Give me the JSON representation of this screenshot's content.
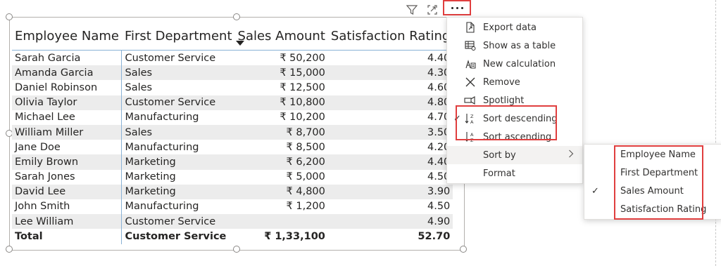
{
  "table": {
    "columns": [
      "Employee Name",
      "First Department",
      "Sales Amount",
      "Satisfaction Rating"
    ],
    "sorted_column": "Sales Amount",
    "rows": [
      [
        "Sarah Garcia",
        "Customer Service",
        "₹ 50,200",
        "4.40"
      ],
      [
        "Amanda Garcia",
        "Sales",
        "₹ 15,000",
        "4.30"
      ],
      [
        "Daniel Robinson",
        "Sales",
        "₹ 12,500",
        "4.60"
      ],
      [
        "Olivia Taylor",
        "Customer Service",
        "₹ 10,800",
        "4.80"
      ],
      [
        "Michael Lee",
        "Manufacturing",
        "₹ 10,200",
        "4.70"
      ],
      [
        "William Miller",
        "Sales",
        "₹ 8,700",
        "3.50"
      ],
      [
        "Jane Doe",
        "Manufacturing",
        "₹ 8,500",
        "4.20"
      ],
      [
        "Emily Brown",
        "Marketing",
        "₹ 6,200",
        "4.40"
      ],
      [
        "Sarah Jones",
        "Marketing",
        "₹ 5,000",
        "4.50"
      ],
      [
        "David Lee",
        "Marketing",
        "₹ 4,800",
        "3.90"
      ],
      [
        "John Smith",
        "Manufacturing",
        "₹ 1,200",
        "4.50"
      ],
      [
        "Lee William",
        "Customer Service",
        "",
        "4.90"
      ]
    ],
    "total": [
      "Total",
      "Customer Service",
      "₹ 1,33,100",
      "52.70"
    ]
  },
  "header_icons": {
    "filter": "filter-icon",
    "focus": "focus-mode-icon",
    "more": "more-options-icon"
  },
  "menu": {
    "items": [
      {
        "label": "Export data",
        "icon": "export-icon"
      },
      {
        "label": "Show as a table",
        "icon": "table-icon"
      },
      {
        "label": "New calculation",
        "icon": "calculation-icon"
      },
      {
        "label": "Remove",
        "icon": "close-icon"
      },
      {
        "label": "Spotlight",
        "icon": "spotlight-icon"
      },
      {
        "label": "Sort descending",
        "icon": "sort-descending-icon",
        "checked": true
      },
      {
        "label": "Sort ascending",
        "icon": "sort-ascending-icon"
      },
      {
        "label": "Sort by",
        "icon": "chevron-right-icon"
      },
      {
        "label": "Format"
      }
    ]
  },
  "submenu": {
    "items": [
      {
        "label": "Employee Name"
      },
      {
        "label": "First Department"
      },
      {
        "label": "Sales Amount",
        "checked": true
      },
      {
        "label": "Satisfaction Rating"
      }
    ]
  },
  "colors": {
    "highlight": "#e03e3e",
    "row_band": "#ececec",
    "column_divider": "#8ab2d6"
  }
}
